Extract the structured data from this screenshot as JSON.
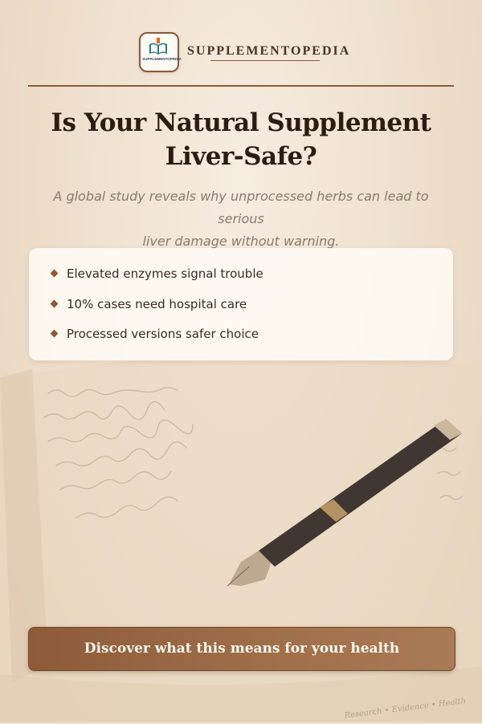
{
  "brand": {
    "name": "SUPPLEMENTOPEDIA",
    "logo_text": "SUPPLEMENTOPEDIA",
    "logo_icon": "open-book-icon"
  },
  "headline": {
    "line1": "Is Your Natural Supplement",
    "line2": "Liver-Safe?"
  },
  "subheadline": {
    "line1": "A global study reveals why unprocessed herbs can lead to serious",
    "line2": "liver damage without warning."
  },
  "bullets": [
    {
      "icon": "diamond-bullet-icon",
      "text": "Elevated enzymes signal trouble"
    },
    {
      "icon": "diamond-bullet-icon",
      "text": "10% cases need hospital care"
    },
    {
      "icon": "diamond-bullet-icon",
      "text": "Processed versions safer choice"
    }
  ],
  "cta": {
    "label": "Discover what this means for your health"
  },
  "footer": {
    "tagline": "Research • Evidence • Health"
  },
  "colors": {
    "accent": "#8b5a3a",
    "background": "#efe2d0",
    "heading": "#2b1d12",
    "button": "#9a6a45"
  }
}
